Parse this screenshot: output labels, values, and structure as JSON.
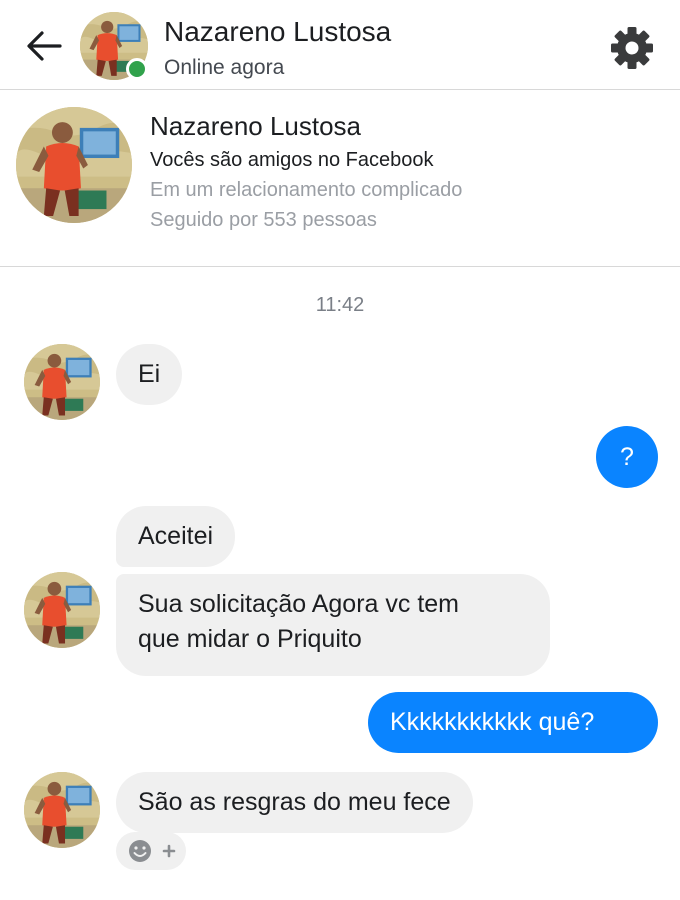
{
  "header": {
    "name": "Nazareno Lustosa",
    "status": "Online agora"
  },
  "profile": {
    "name": "Nazareno Lustosa",
    "friends_line": "Vocês são amigos no Facebook",
    "relationship": "Em um relacionamento complicado",
    "followers": "Seguido por 553 pessoas"
  },
  "chat": {
    "timestamp": "11:42",
    "messages": [
      {
        "from": "them",
        "text": "Ei"
      },
      {
        "from": "me",
        "text": "?"
      },
      {
        "from": "them",
        "text": "Aceitei"
      },
      {
        "from": "them",
        "text_line1": "Sua solicitação Agora vc tem",
        "text_line2": "que midar o Priquito"
      },
      {
        "from": "me",
        "text": "Kkkkkkkkkkk quê?"
      },
      {
        "from": "them",
        "text": "São as resgras do meu fece"
      }
    ]
  },
  "icons": {
    "back": "arrow-left-icon",
    "settings": "gear-icon",
    "reaction": "smiley-plus-icon"
  },
  "colors": {
    "sent_bubble": "#0a84ff",
    "received_bubble": "#f0f0f0",
    "online": "#31a24c"
  }
}
